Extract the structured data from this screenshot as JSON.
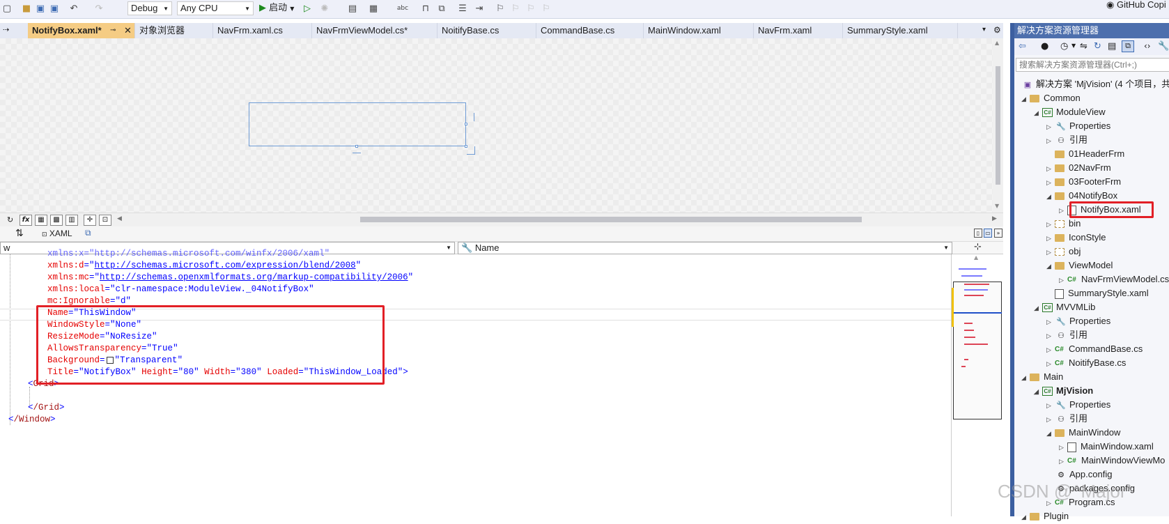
{
  "toolbar": {
    "config": "Debug",
    "platform": "Any CPU",
    "start_label": "启动",
    "copilot": "GitHub Copi"
  },
  "tabs": [
    {
      "label": "NotifyBox.xaml*",
      "active": true
    },
    {
      "label": "对象浏览器"
    },
    {
      "label": "NavFrm.xaml.cs"
    },
    {
      "label": "NavFrmViewModel.cs*"
    },
    {
      "label": "NoitifyBase.cs"
    },
    {
      "label": "CommandBase.cs"
    },
    {
      "label": "MainWindow.xaml"
    },
    {
      "label": "NavFrm.xaml"
    },
    {
      "label": "SummaryStyle.xaml"
    }
  ],
  "split": {
    "xaml_label": "XAML"
  },
  "nav": {
    "left": "w",
    "right": "Name"
  },
  "code": {
    "line0": "xmlns:x=\"http://schemas.microsoft.com/winfx/2006/xaml\"",
    "line1_attr": "xmlns:d",
    "line1_val": "http://schemas.microsoft.com/expression/blend/2008",
    "line2_attr": "xmlns:mc",
    "line2_val": "http://schemas.openxmlformats.org/markup-compatibility/2006",
    "line3_attr": "xmlns:local",
    "line3_val": "clr-namespace:ModuleView._04NotifyBox",
    "line4_attr": "mc:Ignorable",
    "line4_val": "d",
    "line5_attr": "Name",
    "line5_val": "ThisWindow",
    "line6_attr": "WindowStyle",
    "line6_val": "None",
    "line7_attr": "ResizeMode",
    "line7_val": "NoResize",
    "line8_attr": "AllowsTransparency",
    "line8_val": "True",
    "line9_attr": "Background",
    "line9_val": "Transparent",
    "line10_a1": "Title",
    "line10_v1": "NotifyBox",
    "line10_a2": "Height",
    "line10_v2": "80",
    "line10_a3": "Width",
    "line10_v3": "380",
    "line10_a4": "Loaded",
    "line10_v4": "ThisWindow_Loaded",
    "line11": "Grid",
    "line12": "/Grid",
    "line13": "/Window"
  },
  "solution": {
    "title": "解决方案资源管理器",
    "search_placeholder": "搜索解决方案资源管理器(Ctrl+;)",
    "items": [
      {
        "label": "解决方案 'MjVision' (4 个项目，共 4"
      },
      {
        "label": "Common"
      },
      {
        "label": "ModuleView"
      },
      {
        "label": "Properties"
      },
      {
        "label": "引用"
      },
      {
        "label": "01HeaderFrm"
      },
      {
        "label": "02NavFrm"
      },
      {
        "label": "03FooterFrm"
      },
      {
        "label": "04NotifyBox"
      },
      {
        "label": "NotifyBox.xaml"
      },
      {
        "label": "bin"
      },
      {
        "label": "IconStyle"
      },
      {
        "label": "obj"
      },
      {
        "label": "ViewModel"
      },
      {
        "label": "NavFrmViewModel.cs"
      },
      {
        "label": "SummaryStyle.xaml"
      },
      {
        "label": "MVVMLib"
      },
      {
        "label": "Properties"
      },
      {
        "label": "引用"
      },
      {
        "label": "CommandBase.cs"
      },
      {
        "label": "NoitifyBase.cs"
      },
      {
        "label": "Main"
      },
      {
        "label": "MjVision"
      },
      {
        "label": "Properties"
      },
      {
        "label": "引用"
      },
      {
        "label": "MainWindow"
      },
      {
        "label": "MainWindow.xaml"
      },
      {
        "label": "MainWindowViewMo"
      },
      {
        "label": "App.config"
      },
      {
        "label": "packages.config"
      },
      {
        "label": "Program.cs"
      },
      {
        "label": "Plugin"
      }
    ]
  },
  "watermark": "CSDN @^Major*"
}
